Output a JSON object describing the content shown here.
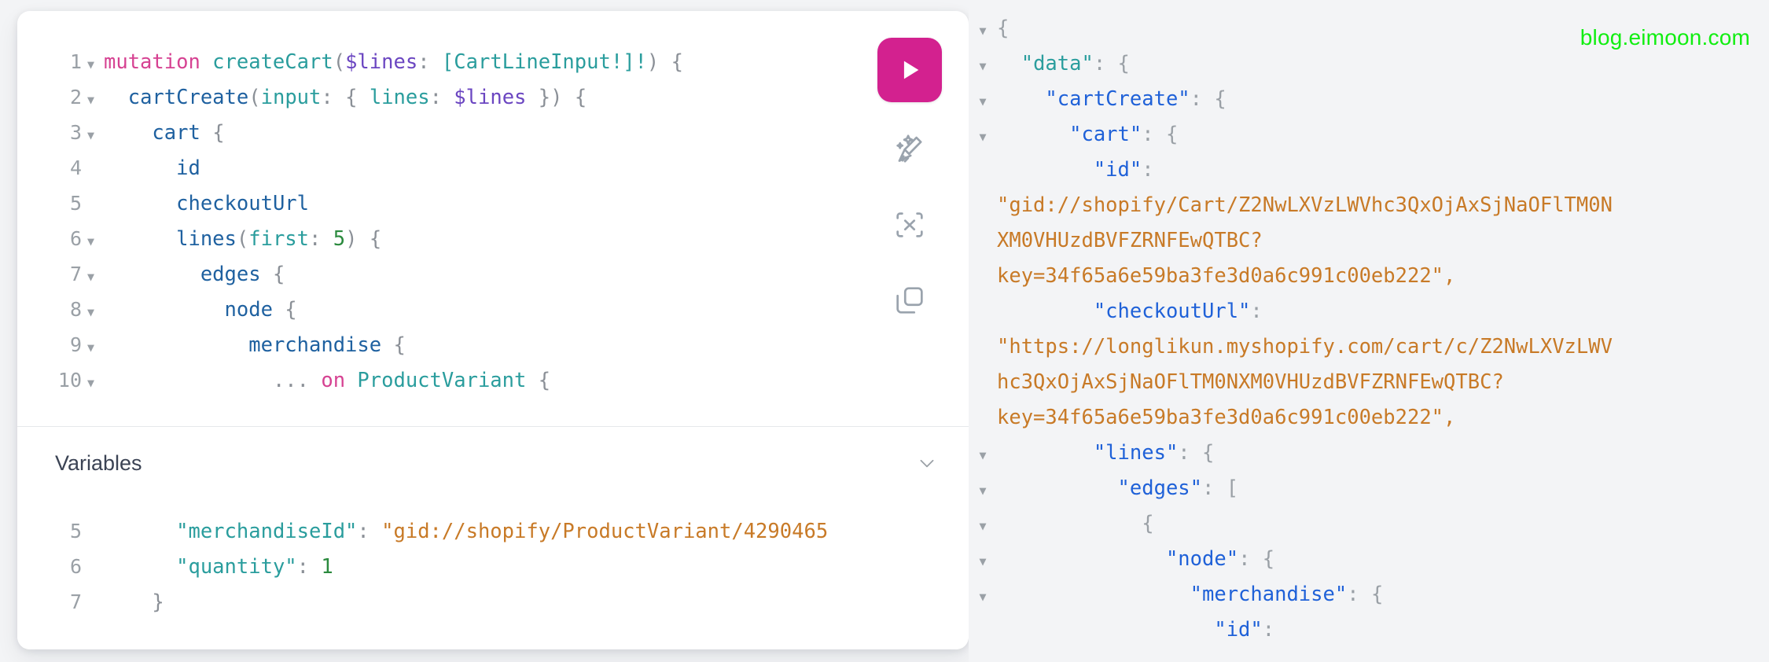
{
  "watermark": "blog.eimoon.com",
  "editor": {
    "query_lines": [
      {
        "num": "1",
        "fold": true,
        "tokens": [
          {
            "t": "mutation ",
            "c": "kw"
          },
          {
            "t": "createCart",
            "c": "def"
          },
          {
            "t": "(",
            "c": "punct"
          },
          {
            "t": "$lines",
            "c": "var"
          },
          {
            "t": ": ",
            "c": "punct"
          },
          {
            "t": "[CartLineInput!]!",
            "c": "def"
          },
          {
            "t": ") ",
            "c": "punct"
          },
          {
            "t": "{",
            "c": "punct"
          }
        ]
      },
      {
        "num": "2",
        "fold": true,
        "tokens": [
          {
            "t": "  ",
            "c": "punct"
          },
          {
            "t": "cartCreate",
            "c": "field"
          },
          {
            "t": "(",
            "c": "punct"
          },
          {
            "t": "input",
            "c": "arg"
          },
          {
            "t": ": ",
            "c": "punct"
          },
          {
            "t": "{ ",
            "c": "punct"
          },
          {
            "t": "lines",
            "c": "arg"
          },
          {
            "t": ": ",
            "c": "punct"
          },
          {
            "t": "$lines",
            "c": "var"
          },
          {
            "t": " }) ",
            "c": "punct"
          },
          {
            "t": "{",
            "c": "punct"
          }
        ]
      },
      {
        "num": "3",
        "fold": true,
        "tokens": [
          {
            "t": "    ",
            "c": "punct"
          },
          {
            "t": "cart",
            "c": "field"
          },
          {
            "t": " {",
            "c": "punct"
          }
        ]
      },
      {
        "num": "4",
        "fold": false,
        "tokens": [
          {
            "t": "      ",
            "c": "punct"
          },
          {
            "t": "id",
            "c": "field"
          }
        ]
      },
      {
        "num": "5",
        "fold": false,
        "tokens": [
          {
            "t": "      ",
            "c": "punct"
          },
          {
            "t": "checkoutUrl",
            "c": "field"
          }
        ]
      },
      {
        "num": "6",
        "fold": true,
        "tokens": [
          {
            "t": "      ",
            "c": "punct"
          },
          {
            "t": "lines",
            "c": "field"
          },
          {
            "t": "(",
            "c": "punct"
          },
          {
            "t": "first",
            "c": "arg"
          },
          {
            "t": ": ",
            "c": "punct"
          },
          {
            "t": "5",
            "c": "num"
          },
          {
            "t": ") ",
            "c": "punct"
          },
          {
            "t": "{",
            "c": "punct"
          }
        ]
      },
      {
        "num": "7",
        "fold": true,
        "tokens": [
          {
            "t": "        ",
            "c": "punct"
          },
          {
            "t": "edges",
            "c": "field"
          },
          {
            "t": " {",
            "c": "punct"
          }
        ]
      },
      {
        "num": "8",
        "fold": true,
        "tokens": [
          {
            "t": "          ",
            "c": "punct"
          },
          {
            "t": "node",
            "c": "field"
          },
          {
            "t": " {",
            "c": "punct"
          }
        ]
      },
      {
        "num": "9",
        "fold": true,
        "tokens": [
          {
            "t": "            ",
            "c": "punct"
          },
          {
            "t": "merchandise",
            "c": "field"
          },
          {
            "t": " {",
            "c": "punct"
          }
        ]
      },
      {
        "num": "10",
        "fold": true,
        "tokens": [
          {
            "t": "              ",
            "c": "punct"
          },
          {
            "t": "... ",
            "c": "punct"
          },
          {
            "t": "on ",
            "c": "kw"
          },
          {
            "t": "ProductVariant",
            "c": "def"
          },
          {
            "t": " {",
            "c": "punct"
          }
        ]
      }
    ],
    "variables": {
      "title": "Variables",
      "collapse_icon": "chevron-down-icon",
      "lines": [
        {
          "num": "5",
          "tokens": [
            {
              "t": "      ",
              "c": "punct"
            },
            {
              "t": "\"merchandiseId\"",
              "c": "key"
            },
            {
              "t": ": ",
              "c": "punct"
            },
            {
              "t": "\"gid://shopify/ProductVariant/4290465",
              "c": "str"
            }
          ]
        },
        {
          "num": "6",
          "tokens": [
            {
              "t": "      ",
              "c": "punct"
            },
            {
              "t": "\"quantity\"",
              "c": "key"
            },
            {
              "t": ": ",
              "c": "punct"
            },
            {
              "t": "1",
              "c": "num"
            }
          ]
        },
        {
          "num": "7",
          "tokens": [
            {
              "t": "    ",
              "c": "punct"
            },
            {
              "t": "}",
              "c": "punct"
            }
          ]
        }
      ]
    },
    "toolbar": {
      "execute_label": "play-icon",
      "prettify_label": "prettify-icon",
      "merge_label": "merge-icon",
      "copy_label": "copy-icon"
    }
  },
  "response": {
    "lines": [
      {
        "fold": true,
        "tokens": [
          {
            "t": "{",
            "c": "punct"
          }
        ]
      },
      {
        "fold": true,
        "tokens": [
          {
            "t": "  ",
            "c": "punct"
          },
          {
            "t": "\"data\"",
            "c": "teal"
          },
          {
            "t": ": {",
            "c": "punct"
          }
        ]
      },
      {
        "fold": true,
        "tokens": [
          {
            "t": "    ",
            "c": "punct"
          },
          {
            "t": "\"cartCreate\"",
            "c": "key"
          },
          {
            "t": ": {",
            "c": "punct"
          }
        ]
      },
      {
        "fold": true,
        "tokens": [
          {
            "t": "      ",
            "c": "punct"
          },
          {
            "t": "\"cart\"",
            "c": "key"
          },
          {
            "t": ": {",
            "c": "punct"
          }
        ]
      },
      {
        "fold": false,
        "tokens": [
          {
            "t": "        ",
            "c": "punct"
          },
          {
            "t": "\"id\"",
            "c": "key"
          },
          {
            "t": ":",
            "c": "punct"
          }
        ]
      },
      {
        "fold": false,
        "tokens": [
          {
            "t": "\"gid://shopify/Cart/Z2NwLXVzLWVhc3QxOjAxSjNaOFlTM0N",
            "c": "str"
          }
        ]
      },
      {
        "fold": false,
        "tokens": [
          {
            "t": "XM0VHUzdBVFZRNFEwQTBC?",
            "c": "str"
          }
        ]
      },
      {
        "fold": false,
        "tokens": [
          {
            "t": "key=34f65a6e59ba3fe3d0a6c991c00eb222\",",
            "c": "str"
          }
        ]
      },
      {
        "fold": false,
        "tokens": [
          {
            "t": "        ",
            "c": "punct"
          },
          {
            "t": "\"checkoutUrl\"",
            "c": "key"
          },
          {
            "t": ":",
            "c": "punct"
          }
        ]
      },
      {
        "fold": false,
        "tokens": [
          {
            "t": "\"https://longlikun.myshopify.com/cart/c/Z2NwLXVzLWV",
            "c": "str"
          }
        ]
      },
      {
        "fold": false,
        "tokens": [
          {
            "t": "hc3QxOjAxSjNaOFlTM0NXM0VHUzdBVFZRNFEwQTBC?",
            "c": "str"
          }
        ]
      },
      {
        "fold": false,
        "tokens": [
          {
            "t": "key=34f65a6e59ba3fe3d0a6c991c00eb222\",",
            "c": "str"
          }
        ]
      },
      {
        "fold": true,
        "tokens": [
          {
            "t": "        ",
            "c": "punct"
          },
          {
            "t": "\"lines\"",
            "c": "key"
          },
          {
            "t": ": {",
            "c": "punct"
          }
        ]
      },
      {
        "fold": true,
        "tokens": [
          {
            "t": "          ",
            "c": "punct"
          },
          {
            "t": "\"edges\"",
            "c": "key"
          },
          {
            "t": ": [",
            "c": "punct"
          }
        ]
      },
      {
        "fold": true,
        "tokens": [
          {
            "t": "            ",
            "c": "punct"
          },
          {
            "t": "{",
            "c": "punct"
          }
        ]
      },
      {
        "fold": true,
        "tokens": [
          {
            "t": "              ",
            "c": "punct"
          },
          {
            "t": "\"node\"",
            "c": "key"
          },
          {
            "t": ": {",
            "c": "punct"
          }
        ]
      },
      {
        "fold": true,
        "tokens": [
          {
            "t": "                ",
            "c": "punct"
          },
          {
            "t": "\"merchandise\"",
            "c": "key"
          },
          {
            "t": ": {",
            "c": "punct"
          }
        ]
      },
      {
        "fold": false,
        "tokens": [
          {
            "t": "                  ",
            "c": "punct"
          },
          {
            "t": "\"id\"",
            "c": "key"
          },
          {
            "t": ":",
            "c": "punct"
          }
        ]
      }
    ]
  }
}
